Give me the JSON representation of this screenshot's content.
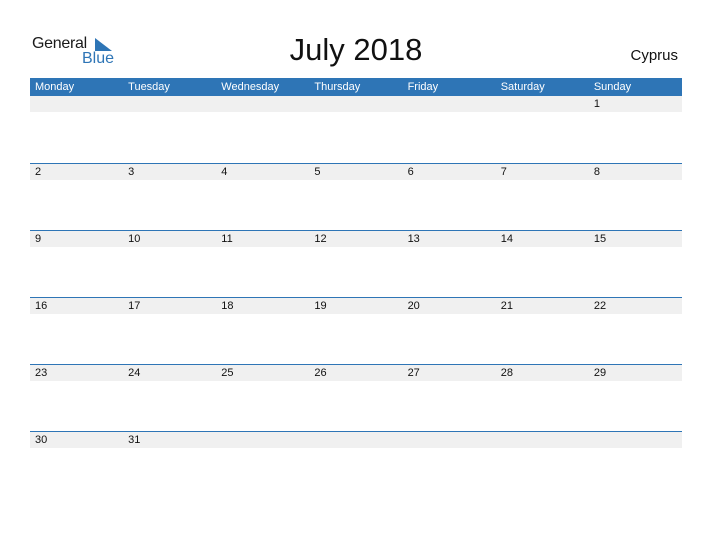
{
  "logo": {
    "general": "General",
    "blue": "Blue"
  },
  "title": "July 2018",
  "country": "Cyprus",
  "colors": {
    "accent": "#2e75b6",
    "strip": "#f0f0f0"
  },
  "weekdays": [
    "Monday",
    "Tuesday",
    "Wednesday",
    "Thursday",
    "Friday",
    "Saturday",
    "Sunday"
  ],
  "weeks": [
    [
      "",
      "",
      "",
      "",
      "",
      "",
      "1"
    ],
    [
      "2",
      "3",
      "4",
      "5",
      "6",
      "7",
      "8"
    ],
    [
      "9",
      "10",
      "11",
      "12",
      "13",
      "14",
      "15"
    ],
    [
      "16",
      "17",
      "18",
      "19",
      "20",
      "21",
      "22"
    ],
    [
      "23",
      "24",
      "25",
      "26",
      "27",
      "28",
      "29"
    ],
    [
      "30",
      "31",
      "",
      "",
      "",
      "",
      ""
    ]
  ]
}
